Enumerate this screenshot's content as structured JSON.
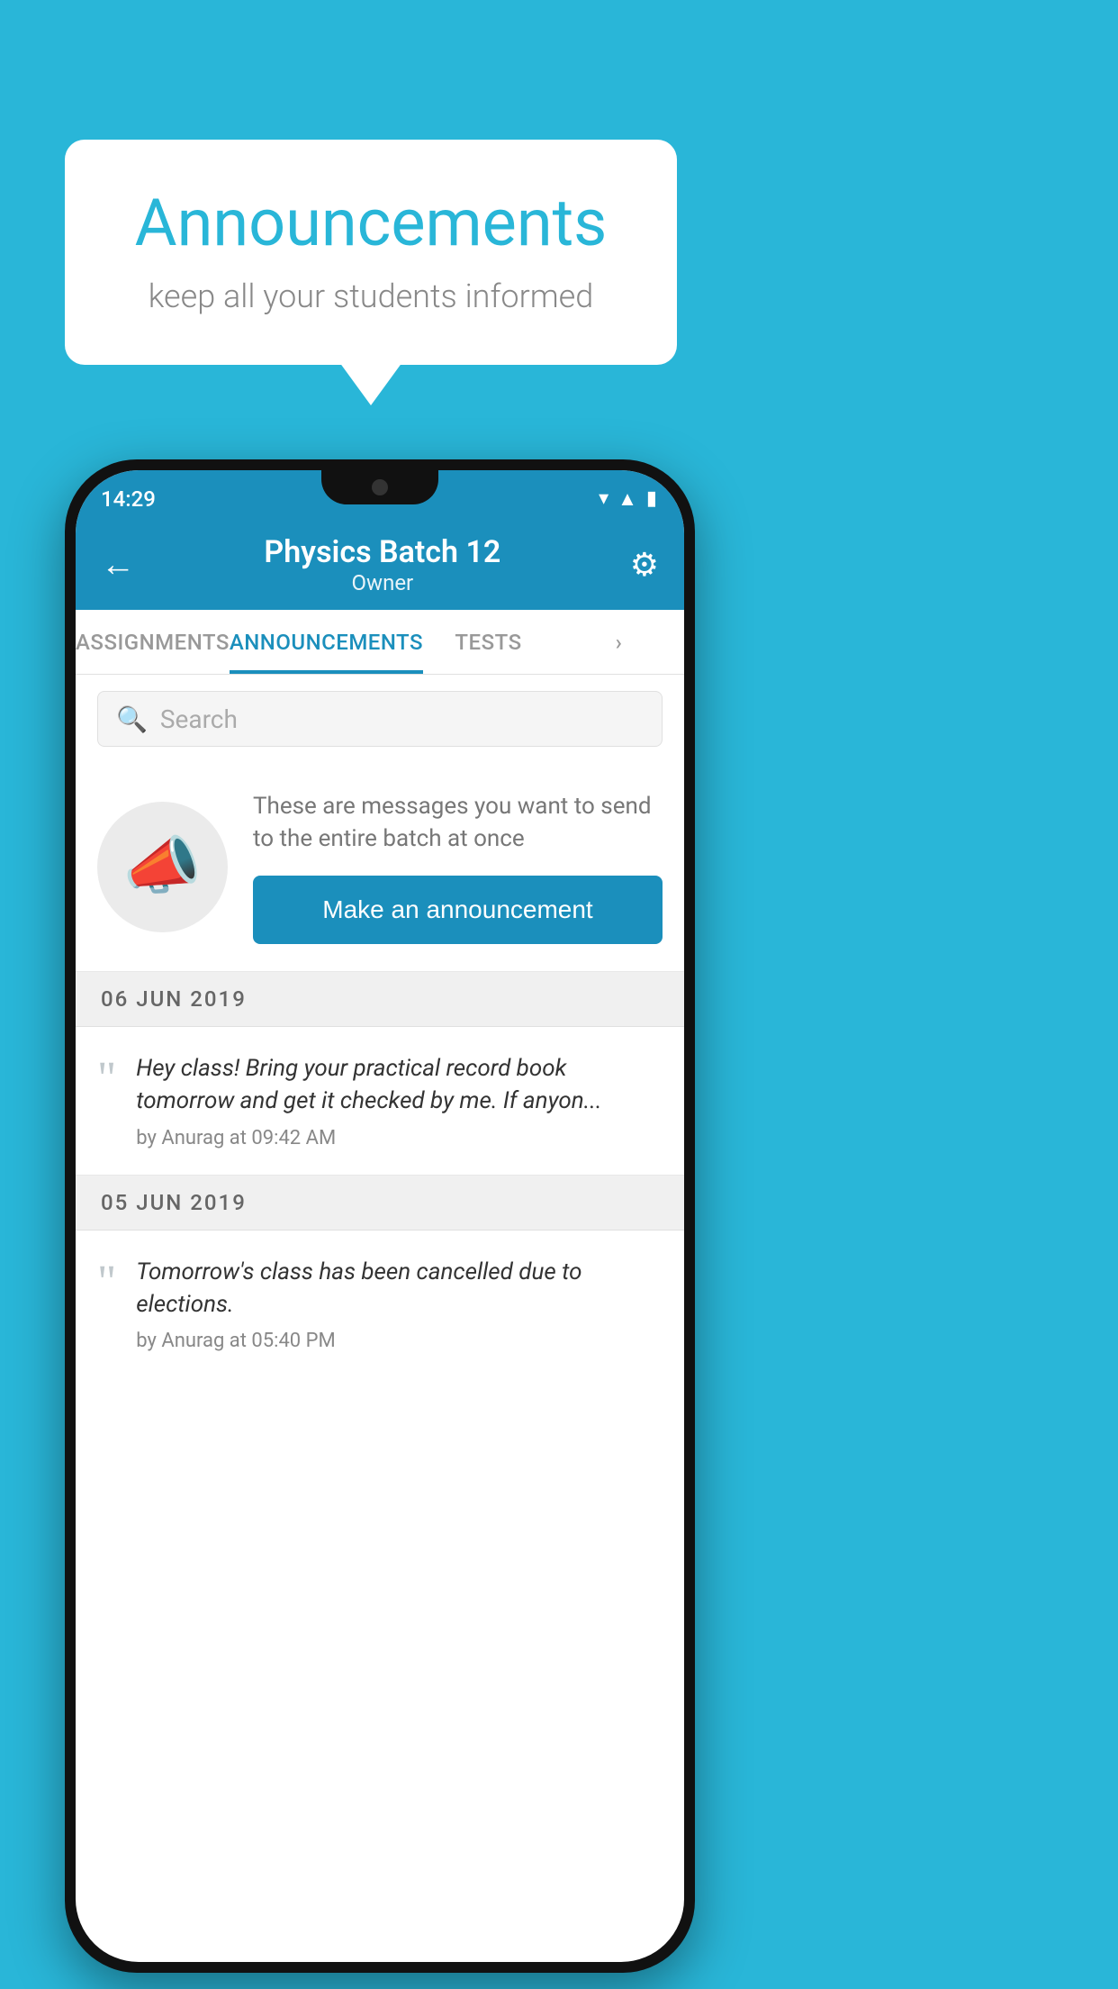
{
  "background_color": "#29b6d8",
  "speech_bubble": {
    "title": "Announcements",
    "subtitle": "keep all your students informed"
  },
  "phone": {
    "status_bar": {
      "time": "14:29",
      "icons": [
        "wifi",
        "signal",
        "battery"
      ]
    },
    "header": {
      "title": "Physics Batch 12",
      "subtitle": "Owner",
      "back_label": "←",
      "settings_label": "⚙"
    },
    "tabs": [
      {
        "label": "ASSIGNMENTS",
        "active": false
      },
      {
        "label": "ANNOUNCEMENTS",
        "active": true
      },
      {
        "label": "TESTS",
        "active": false
      },
      {
        "label": "",
        "active": false
      }
    ],
    "search": {
      "placeholder": "Search"
    },
    "announcement_prompt": {
      "description": "These are messages you want to send to the entire batch at once",
      "button_label": "Make an announcement"
    },
    "announcements": [
      {
        "date": "06  JUN  2019",
        "text": "Hey class! Bring your practical record book tomorrow and get it checked by me. If anyon...",
        "meta": "by Anurag at 09:42 AM"
      },
      {
        "date": "05  JUN  2019",
        "text": "Tomorrow's class has been cancelled due to elections.",
        "meta": "by Anurag at 05:40 PM"
      }
    ]
  }
}
